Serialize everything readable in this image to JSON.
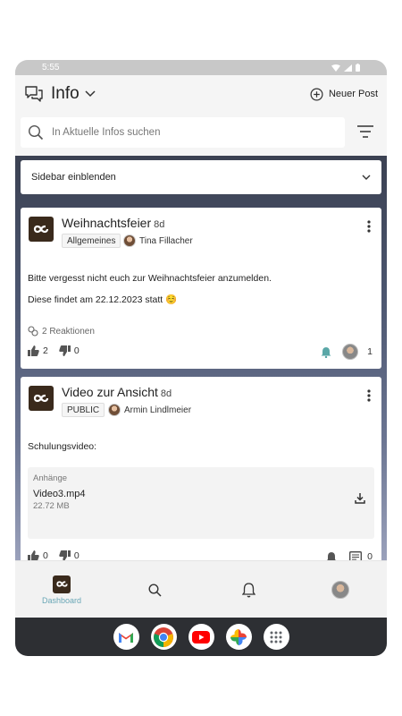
{
  "status": {
    "time": "5:55"
  },
  "header": {
    "title": "Info",
    "new_post_label": "Neuer Post"
  },
  "search": {
    "placeholder": "In Aktuelle Infos suchen"
  },
  "sidebar_toggle": {
    "label": "Sidebar einblenden"
  },
  "posts": [
    {
      "title": "Weihnachtsfeier",
      "age": "8d",
      "tag": "Allgemeines",
      "author": "Tina Fillacher",
      "lines": [
        "Bitte vergesst nicht euch zur Weihnachtsfeier anzumelden.",
        "Diese findet am 22.12.2023 statt ☺️"
      ],
      "reactions": "2 Reaktionen",
      "likes": "2",
      "dislikes": "0",
      "viewers": "1"
    },
    {
      "title": "Video zur Ansicht",
      "age": "8d",
      "tag": "PUBLIC",
      "author": "Armin Lindlmeier",
      "lines": [
        "Schulungsvideo:"
      ],
      "attachment": {
        "label": "Anhänge",
        "name": "Video3.mp4",
        "size": "22.72 MB"
      },
      "likes": "0",
      "dislikes": "0",
      "comments": "0"
    }
  ],
  "bottom_nav": {
    "dashboard_label": "Dashboard"
  },
  "colors": {
    "accent": "#6aa7b6",
    "logo_bg": "#3a2a1c",
    "bell_teal": "#5aa7a7"
  },
  "dock": [
    "gmail-icon",
    "chrome-icon",
    "youtube-icon",
    "photos-icon",
    "apps-icon"
  ]
}
